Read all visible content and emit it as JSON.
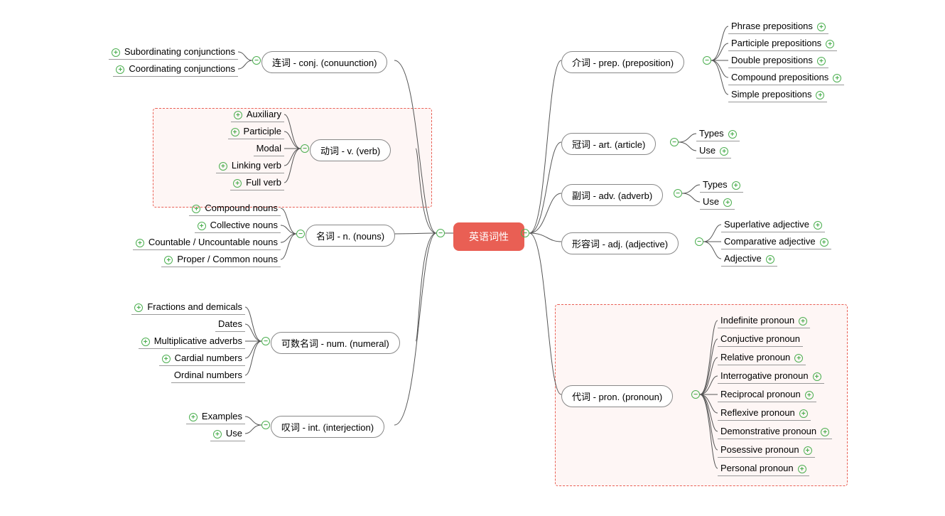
{
  "center": {
    "label": "英语词性"
  },
  "left": {
    "conj": {
      "label": "连词 - conj. (conuunction)",
      "children": [
        {
          "label": "Subordinating conjunctions",
          "expand": true
        },
        {
          "label": "Coordinating conjunctions",
          "expand": true
        }
      ]
    },
    "verb": {
      "label": "动词 - v. (verb)",
      "children": [
        {
          "label": "Auxiliary",
          "expand": true
        },
        {
          "label": "Participle",
          "expand": true
        },
        {
          "label": "Modal",
          "expand": false
        },
        {
          "label": "Linking verb",
          "expand": true
        },
        {
          "label": "Full  verb",
          "expand": true
        }
      ]
    },
    "noun": {
      "label": "名词 - n. (nouns)",
      "children": [
        {
          "label": "Compound nouns",
          "expand": true
        },
        {
          "label": "Collective nouns",
          "expand": true
        },
        {
          "label": "Countable / Uncountable nouns",
          "expand": true
        },
        {
          "label": "Proper / Common nouns",
          "expand": true
        }
      ]
    },
    "num": {
      "label": "可数名词 - num. (numeral)",
      "children": [
        {
          "label": "Fractions and demicals",
          "expand": true
        },
        {
          "label": "Dates",
          "expand": false
        },
        {
          "label": "Multiplicative adverbs",
          "expand": true
        },
        {
          "label": "Cardial numbers",
          "expand": true
        },
        {
          "label": "Ordinal numbers",
          "expand": false
        }
      ]
    },
    "int": {
      "label": "叹词 - int. (interjection)",
      "children": [
        {
          "label": "Examples",
          "expand": true
        },
        {
          "label": "Use",
          "expand": true
        }
      ]
    }
  },
  "right": {
    "prep": {
      "label": "介词 - prep. (preposition)",
      "children": [
        {
          "label": "Phrase prepositions",
          "expand": true
        },
        {
          "label": "Participle prepositions",
          "expand": true
        },
        {
          "label": "Double prepositions",
          "expand": true
        },
        {
          "label": "Compound prepositions",
          "expand": true
        },
        {
          "label": "Simple prepositions",
          "expand": true
        }
      ]
    },
    "art": {
      "label": "冠词 - art. (article)",
      "children": [
        {
          "label": "Types",
          "expand": true
        },
        {
          "label": "Use",
          "expand": true
        }
      ]
    },
    "adv": {
      "label": "副词 - adv. (adverb)",
      "children": [
        {
          "label": "Types",
          "expand": true
        },
        {
          "label": "Use",
          "expand": true
        }
      ]
    },
    "adj": {
      "label": "形容词 - adj. (adjective)",
      "children": [
        {
          "label": "Superlative adjective",
          "expand": true
        },
        {
          "label": "Comparative adjective",
          "expand": true
        },
        {
          "label": "Adjective",
          "expand": true
        }
      ]
    },
    "pron": {
      "label": "代词 - pron. (pronoun)",
      "children": [
        {
          "label": "Indefinite pronoun",
          "expand": true
        },
        {
          "label": "Conjuctive pronoun",
          "expand": false
        },
        {
          "label": "Relative pronoun",
          "expand": true
        },
        {
          "label": "Interrogative pronoun",
          "expand": true
        },
        {
          "label": "Reciprocal pronoun",
          "expand": true
        },
        {
          "label": "Reflexive pronoun",
          "expand": true
        },
        {
          "label": "Demonstrative pronoun",
          "expand": true
        },
        {
          "label": "Posessive pronoun",
          "expand": true
        },
        {
          "label": "Personal pronoun",
          "expand": true
        }
      ]
    }
  }
}
